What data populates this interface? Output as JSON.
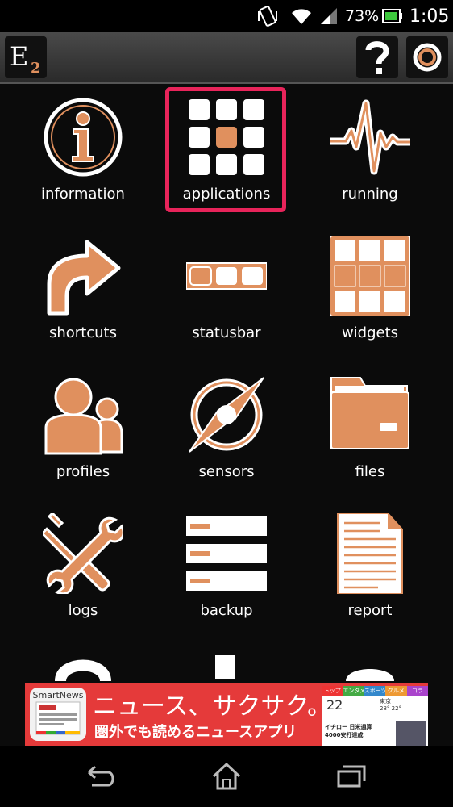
{
  "status_bar": {
    "battery": "73%",
    "time": "1:05"
  },
  "action_bar": {
    "logo": "E2",
    "help_icon": "question-icon",
    "power_icon": "power-icon"
  },
  "tiles": [
    {
      "label": "information"
    },
    {
      "label": "applications",
      "selected": true
    },
    {
      "label": "running"
    },
    {
      "label": "shortcuts"
    },
    {
      "label": "statusbar"
    },
    {
      "label": "widgets"
    },
    {
      "label": "profiles"
    },
    {
      "label": "sensors"
    },
    {
      "label": "files"
    },
    {
      "label": "logs"
    },
    {
      "label": "backup"
    },
    {
      "label": "report"
    }
  ],
  "ad": {
    "brand": "SmartNews",
    "headline": "ニュース、サクサク。",
    "subline": "圏外でも読めるニュースアプリ",
    "phone_tabs": [
      "トップ",
      "エンタメ",
      "スポーツ",
      "グルメ",
      "コラ"
    ],
    "phone_date": "22",
    "phone_city": "東京",
    "phone_temp": "28° 22°",
    "phone_headline": "イチロー 日米通算",
    "phone_headline2": "4000安打達成"
  },
  "colors": {
    "accent": "#e0905e",
    "selection": "#e8245a",
    "background": "#0b0b0b"
  }
}
